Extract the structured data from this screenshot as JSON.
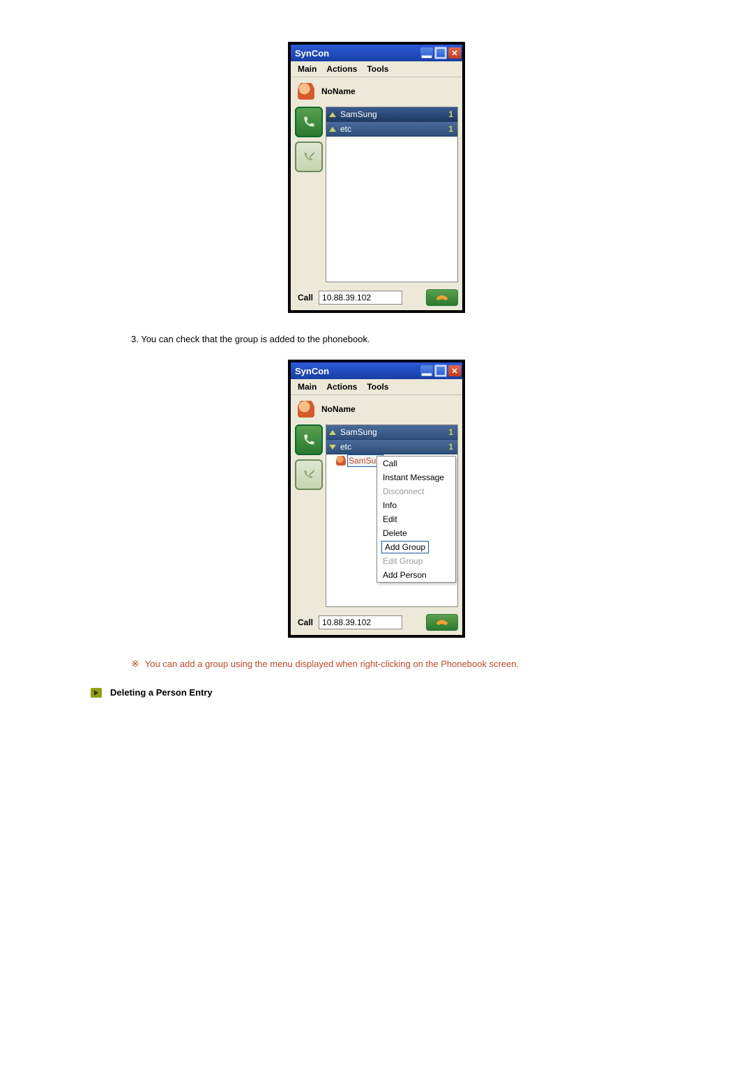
{
  "doc": {
    "step3": "3. You can check that the group is added to the phonebook.",
    "note": "You can add a group using the menu displayed when right-clicking on the Phonebook screen.",
    "section_title": "Deleting a Person Entry"
  },
  "app": {
    "title": "SynCon",
    "menus": {
      "main": "Main",
      "actions": "Actions",
      "tools": "Tools"
    },
    "username": "NoName",
    "groups": [
      {
        "name": "SamSung",
        "count": "1"
      },
      {
        "name": "etc",
        "count": "1"
      }
    ],
    "expanded_contact": "SamSung",
    "status": {
      "call_label": "Call",
      "ip": "10.88.39.102"
    }
  },
  "context_menu": {
    "call": "Call",
    "im": "Instant Message",
    "disconnect": "Disconnect",
    "info": "Info",
    "edit": "Edit",
    "delete": "Delete",
    "add_group": "Add Group",
    "edit_group": "Edit Group",
    "add_person": "Add Person"
  }
}
